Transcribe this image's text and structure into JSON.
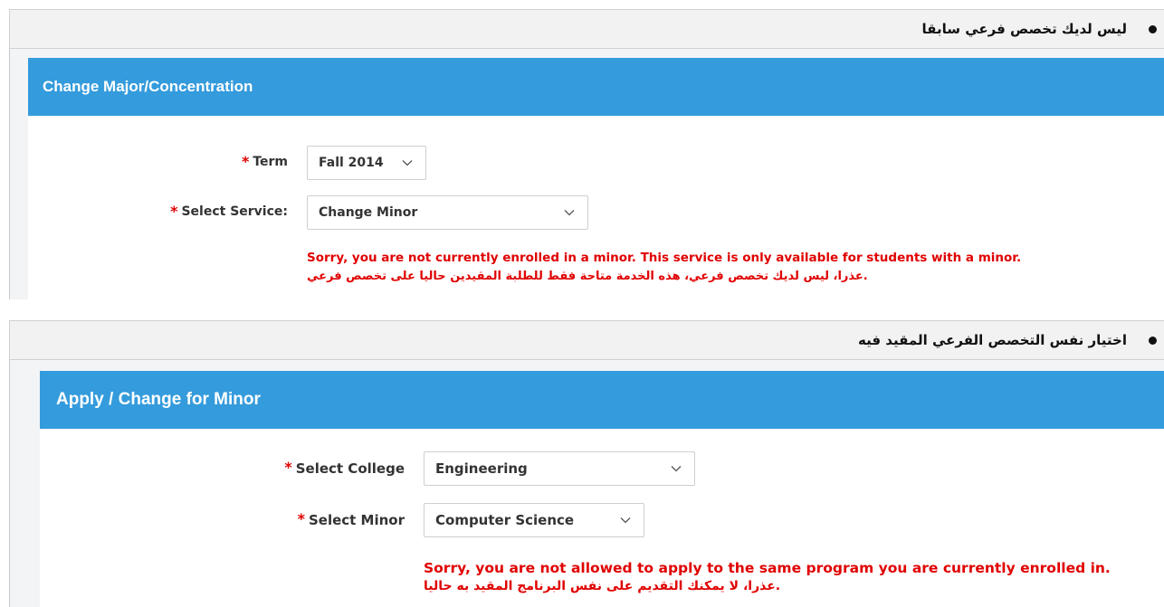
{
  "section1": {
    "bullet_text": "ليس لديك تخصص فرعي سابقا",
    "panel_title": "Change Major/Concentration",
    "term": {
      "required_mark": "*",
      "label": "Term",
      "value": "Fall 2014"
    },
    "service": {
      "required_mark": "*",
      "label": "Select Service:",
      "value": "Change Minor"
    },
    "error_en": "Sorry, you are not currently enrolled in a minor. This service is only available for students with a minor.",
    "error_ar": ".عذرا، ليس لديك تخصص فرعي، هذه الخدمة متاحة فقط للطلبة المقيدين حاليا على تخصص فرعي"
  },
  "section2": {
    "bullet_text": "اختيار نفس التخصص الفرعي المقيد فيه",
    "panel_title": "Apply / Change for Minor",
    "college": {
      "required_mark": "*",
      "label": "Select College",
      "value": "Engineering"
    },
    "minor": {
      "required_mark": "*",
      "label": "Select Minor",
      "value": "Computer Science"
    },
    "error_en": "Sorry, you are not allowed to apply to the same program you are currently enrolled in.",
    "error_ar": ".عذرا، لا يمكنك التقديم على نفس البرنامج المقيد به حاليا"
  },
  "colors": {
    "header_blue": "#349bdc",
    "error_red": "#e00000"
  },
  "icons": [
    "bullet-dot",
    "chevron-down-icon"
  ]
}
